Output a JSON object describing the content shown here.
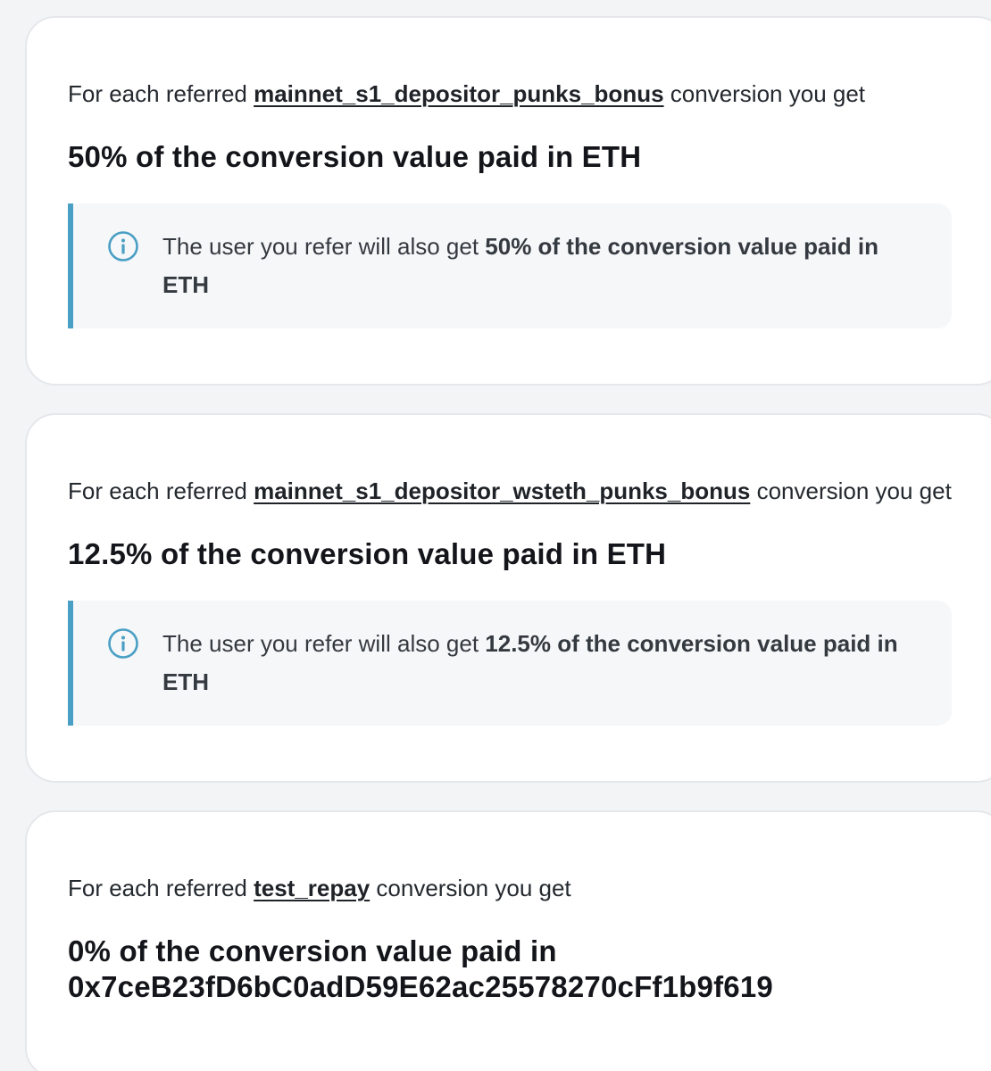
{
  "accent_color": "#4a9fc4",
  "cards": [
    {
      "intro_prefix": "For each referred ",
      "conversion_name": "mainnet_s1_depositor_punks_bonus",
      "intro_suffix": " conversion you get",
      "reward": "50% of the conversion value paid in ETH",
      "notice_prefix": "The user you refer will also get ",
      "notice_bold": "50% of the conversion value paid in ETH",
      "notice_icon": "info-icon"
    },
    {
      "intro_prefix": "For each referred ",
      "conversion_name": "mainnet_s1_depositor_wsteth_punks_bonus",
      "intro_suffix": " conversion you get",
      "reward": "12.5% of the conversion value paid in ETH",
      "notice_prefix": "The user you refer will also get ",
      "notice_bold": "12.5% of the conversion value paid in ETH",
      "notice_icon": "info-icon"
    },
    {
      "intro_prefix": "For each referred ",
      "conversion_name": "test_repay",
      "intro_suffix": " conversion you get",
      "reward_line1": "0% of the conversion value paid in",
      "reward_line2": "0x7ceB23fD6bC0adD59E62ac25578270cFf1b9f619"
    }
  ]
}
